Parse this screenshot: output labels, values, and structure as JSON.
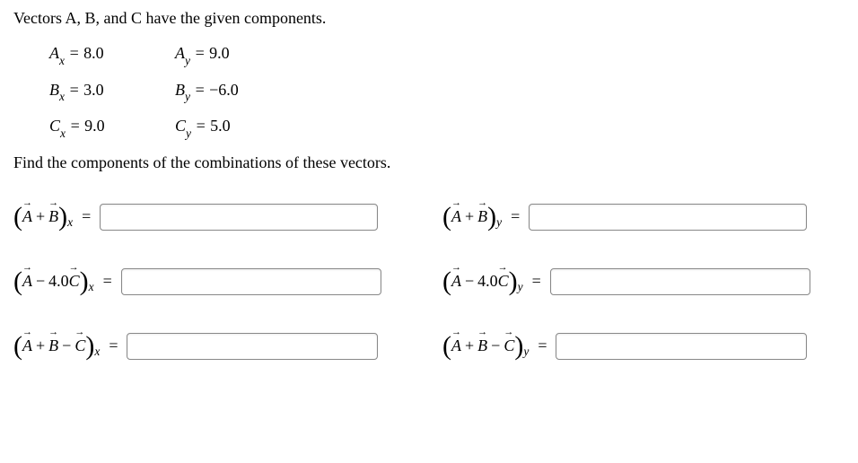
{
  "intro": "Vectors A, B, and C have the given components.",
  "components": {
    "A": {
      "x_label": "A",
      "x_sub": "x",
      "x_val": "8.0",
      "y_label": "A",
      "y_sub": "y",
      "y_val": "9.0"
    },
    "B": {
      "x_label": "B",
      "x_sub": "x",
      "x_val": "3.0",
      "y_label": "B",
      "y_sub": "y",
      "y_val": "−6.0"
    },
    "C": {
      "x_label": "C",
      "x_sub": "x",
      "x_val": "9.0",
      "y_label": "C",
      "y_sub": "y",
      "y_val": "5.0"
    }
  },
  "instruction": "Find the components of the combinations of these vectors.",
  "expressions": {
    "r1c1": {
      "terms": [
        "A",
        "+",
        "B"
      ],
      "sub": "x"
    },
    "r1c2": {
      "terms": [
        "A",
        "+",
        "B"
      ],
      "sub": "y"
    },
    "r2c1": {
      "terms": [
        "A",
        "−",
        "4.0C"
      ],
      "sub": "x"
    },
    "r2c2": {
      "terms": [
        "A",
        "−",
        "4.0C"
      ],
      "sub": "y"
    },
    "r3c1": {
      "terms": [
        "A",
        "+",
        "B",
        "−",
        "C"
      ],
      "sub": "x"
    },
    "r3c2": {
      "terms": [
        "A",
        "+",
        "B",
        "−",
        "C"
      ],
      "sub": "y"
    }
  },
  "sym": {
    "eq": " = ",
    "lp": "(",
    "rp": ")",
    "plus": "+",
    "minus": "−",
    "coef40": "4.0",
    "A": "A",
    "B": "B",
    "C": "C",
    "x": "x",
    "y": "y"
  }
}
